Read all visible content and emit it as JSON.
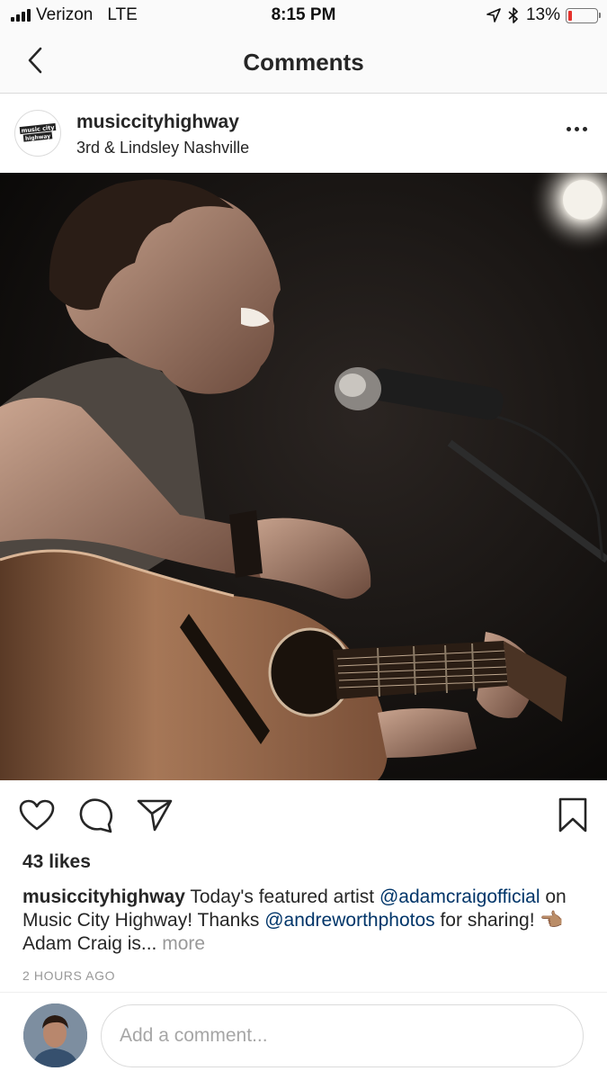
{
  "status_bar": {
    "carrier": "Verizon",
    "network": "LTE",
    "time": "8:15 PM",
    "battery": "13%",
    "battery_level": 0.13,
    "icons": [
      "signal-icon",
      "location-arrow-icon",
      "bluetooth-icon",
      "battery-icon"
    ]
  },
  "nav": {
    "title": "Comments",
    "back_icon": "chevron-left-icon"
  },
  "post": {
    "brand_logo_text": "music city highway",
    "username": "musiccityhighway",
    "location": "3rd & Lindsley Nashville",
    "more_icon": "more-horizontal-icon",
    "photo_description": "guitarist-singing-at-microphone-photo",
    "actions": {
      "like_icon": "heart-icon",
      "comment_icon": "comment-bubble-icon",
      "share_icon": "paper-plane-icon",
      "save_icon": "bookmark-icon"
    },
    "likes": "43 likes",
    "caption": {
      "username": "musiccityhighway",
      "text_1": " Today's featured artist ",
      "mention_1": "@adamcraigofficial",
      "text_2": " on Music City Highway! Thanks ",
      "mention_2": "@andreworthphotos",
      "text_3": " for sharing! 👈🏽 Adam Craig is... ",
      "more": "more"
    },
    "timestamp": "2 HOURS AGO"
  },
  "comment_box": {
    "placeholder": "Add a comment..."
  },
  "colors": {
    "mention": "#003569",
    "muted": "#999999",
    "text": "#262626",
    "battery_low": "#e5312b"
  }
}
